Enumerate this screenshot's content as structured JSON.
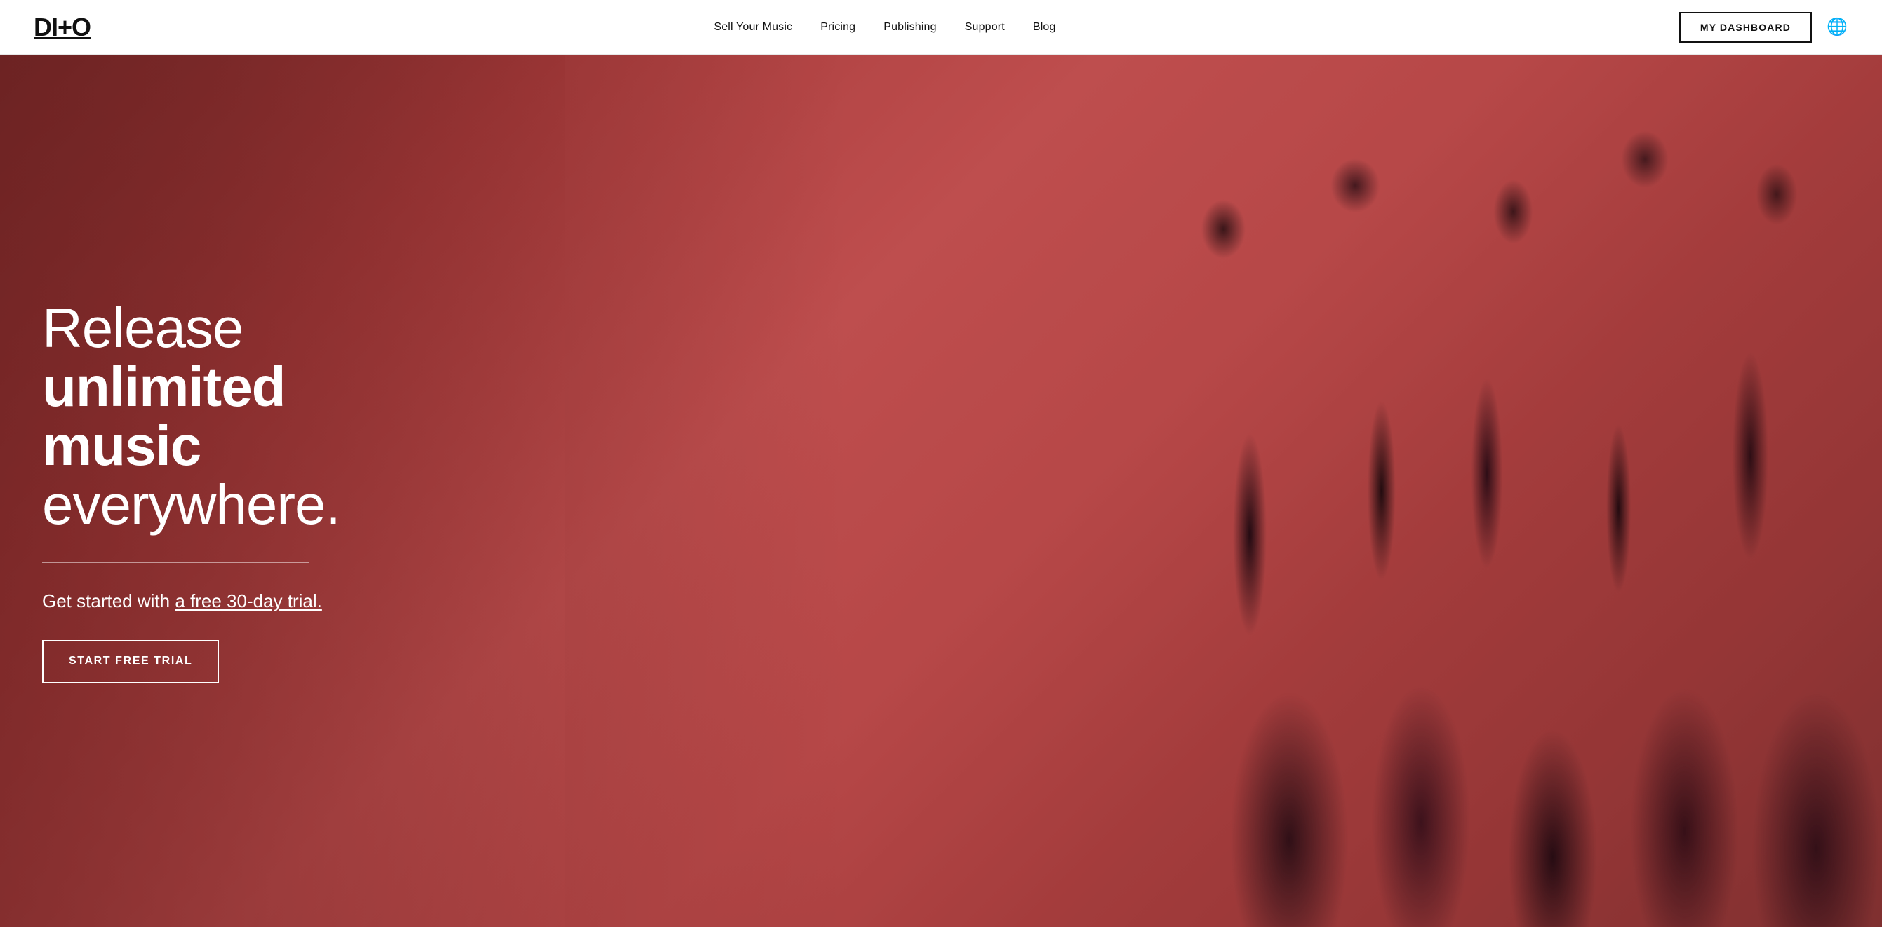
{
  "navbar": {
    "logo": "DI+O",
    "logo_parts": {
      "before_plus": "DI",
      "plus": "+",
      "after_plus": "O"
    },
    "nav_links": [
      {
        "id": "sell-your-music",
        "label": "Sell Your Music",
        "href": "#"
      },
      {
        "id": "pricing",
        "label": "Pricing",
        "href": "#"
      },
      {
        "id": "publishing",
        "label": "Publishing",
        "href": "#"
      },
      {
        "id": "support",
        "label": "Support",
        "href": "#"
      },
      {
        "id": "blog",
        "label": "Blog",
        "href": "#"
      }
    ],
    "dashboard_button": "MY DASHBOARD",
    "globe_icon": "🌐"
  },
  "hero": {
    "title_line1": "Release",
    "title_line2_bold": "unlimited",
    "title_line3_bold": "music",
    "title_line4": "everywhere.",
    "subtitle_text": "Get started with ",
    "subtitle_link": "a free 30-day trial.",
    "cta_button": "START FREE TRIAL",
    "bg_color": "#a63a3a"
  }
}
